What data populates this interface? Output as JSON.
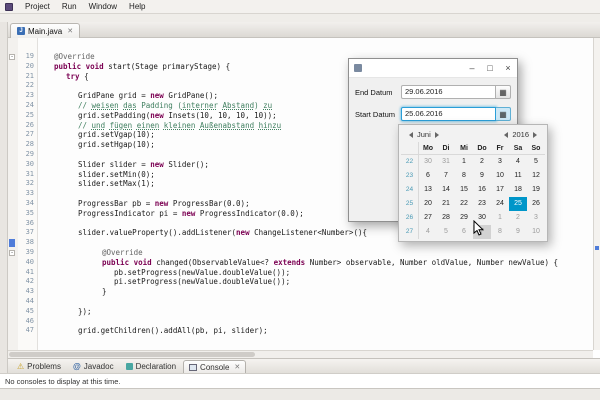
{
  "menubar": {
    "items": [
      "Project",
      "Run",
      "Window",
      "Help"
    ]
  },
  "editor": {
    "tab": "Main.java",
    "tab_close": "✕",
    "fold_glyph": "-",
    "lines": [
      {
        "n": 19,
        "i": 1,
        "fold": true,
        "s": [
          [
            "@Override",
            "ann"
          ]
        ]
      },
      {
        "n": 20,
        "i": 1,
        "s": [
          [
            "public ",
            "kw"
          ],
          [
            "void ",
            "kw"
          ],
          [
            "start(Stage primaryStage) {",
            "p"
          ]
        ]
      },
      {
        "n": 21,
        "i": 2,
        "s": [
          [
            "try ",
            "kw"
          ],
          [
            "{",
            "p"
          ]
        ]
      },
      {
        "n": 22,
        "i": 0,
        "s": []
      },
      {
        "n": 23,
        "i": 3,
        "s": [
          [
            "GridPane grid = ",
            "p"
          ],
          [
            "new ",
            "kw"
          ],
          [
            "GridPane();",
            "p"
          ]
        ]
      },
      {
        "n": 24,
        "i": 3,
        "s": [
          [
            "// ",
            "com"
          ],
          [
            "weisen",
            "comu"
          ],
          [
            " ",
            "com"
          ],
          [
            "das",
            "comu"
          ],
          [
            " Padding (",
            "com"
          ],
          [
            "interner",
            "comu"
          ],
          [
            " ",
            "com"
          ],
          [
            "Abstand",
            "comu"
          ],
          [
            ") ",
            "com"
          ],
          [
            "zu",
            "comu"
          ]
        ]
      },
      {
        "n": 25,
        "i": 3,
        "s": [
          [
            "grid.setPadding(",
            "p"
          ],
          [
            "new ",
            "kw"
          ],
          [
            "Insets(10, 10, 10, 10));",
            "p"
          ]
        ]
      },
      {
        "n": 26,
        "i": 3,
        "s": [
          [
            "// ",
            "com"
          ],
          [
            "und",
            "comu"
          ],
          [
            " ",
            "com"
          ],
          [
            "fügen",
            "comu"
          ],
          [
            " ",
            "com"
          ],
          [
            "einen",
            "comu"
          ],
          [
            " ",
            "com"
          ],
          [
            "kleinen",
            "comu"
          ],
          [
            " ",
            "com"
          ],
          [
            "Außenabstand",
            "comu"
          ],
          [
            " ",
            "com"
          ],
          [
            "hinzu",
            "comu"
          ]
        ]
      },
      {
        "n": 27,
        "i": 3,
        "s": [
          [
            "grid.setVgap(10);",
            "p"
          ]
        ]
      },
      {
        "n": 28,
        "i": 3,
        "s": [
          [
            "grid.setHgap(10);",
            "p"
          ]
        ]
      },
      {
        "n": 29,
        "i": 0,
        "s": []
      },
      {
        "n": 30,
        "i": 3,
        "s": [
          [
            "Slider slider = ",
            "p"
          ],
          [
            "new ",
            "kw"
          ],
          [
            "Slider();",
            "p"
          ]
        ]
      },
      {
        "n": 31,
        "i": 3,
        "s": [
          [
            "slider.setMin(0);",
            "p"
          ]
        ]
      },
      {
        "n": 32,
        "i": 3,
        "s": [
          [
            "slider.setMax(1);",
            "p"
          ]
        ]
      },
      {
        "n": 33,
        "i": 0,
        "s": []
      },
      {
        "n": 34,
        "i": 3,
        "s": [
          [
            "ProgressBar pb = ",
            "p"
          ],
          [
            "new ",
            "kw"
          ],
          [
            "ProgressBar(0.0);",
            "p"
          ]
        ]
      },
      {
        "n": 35,
        "i": 3,
        "s": [
          [
            "ProgressIndicator pi = ",
            "p"
          ],
          [
            "new ",
            "kw"
          ],
          [
            "ProgressIndicator(0.0);",
            "p"
          ]
        ]
      },
      {
        "n": 36,
        "i": 0,
        "s": []
      },
      {
        "n": 37,
        "i": 3,
        "s": [
          [
            "slider.valueProperty().addListener(",
            "p"
          ],
          [
            "new ",
            "kw"
          ],
          [
            "ChangeListener<Number>(){",
            "p"
          ]
        ]
      },
      {
        "n": 38,
        "i": 0,
        "mark": true,
        "s": []
      },
      {
        "n": 39,
        "i": 5,
        "fold": true,
        "s": [
          [
            "@Override",
            "ann"
          ]
        ]
      },
      {
        "n": 40,
        "i": 5,
        "s": [
          [
            "public ",
            "kw"
          ],
          [
            "void ",
            "kw"
          ],
          [
            "changed(ObservableValue<? ",
            "p"
          ],
          [
            "extends ",
            "kw"
          ],
          [
            "Number> observable, Number oldValue, Number newValue) {",
            "p"
          ]
        ]
      },
      {
        "n": 41,
        "i": 6,
        "s": [
          [
            "pb.setProgress(newValue.doubleValue());",
            "p"
          ]
        ]
      },
      {
        "n": 42,
        "i": 6,
        "s": [
          [
            "pi.setProgress(newValue.doubleValue());",
            "p"
          ]
        ]
      },
      {
        "n": 43,
        "i": 5,
        "s": [
          [
            "}",
            "p"
          ]
        ]
      },
      {
        "n": 44,
        "i": 0,
        "s": []
      },
      {
        "n": 45,
        "i": 3,
        "s": [
          [
            "});",
            "p"
          ]
        ]
      },
      {
        "n": 46,
        "i": 0,
        "s": []
      },
      {
        "n": 47,
        "i": 3,
        "s": [
          [
            "grid.getChildren().addAll(pb, pi, slider);",
            "p"
          ]
        ]
      }
    ]
  },
  "dialog": {
    "minimize": "–",
    "maximize": "□",
    "close": "×",
    "picker_icon": "▦",
    "rows": [
      {
        "label": "End Datum",
        "value": "29.06.2016"
      },
      {
        "label": "Start Datum",
        "value": "25.06.2016"
      }
    ]
  },
  "calendar": {
    "month": "Juni",
    "year": "2016",
    "day_headers": [
      "Mo",
      "Di",
      "Mi",
      "Do",
      "Fr",
      "Sa",
      "So"
    ],
    "weeks": [
      {
        "wn": "22",
        "days": [
          [
            "30",
            "o"
          ],
          [
            "31",
            "o"
          ],
          [
            "1",
            ""
          ],
          [
            "2",
            ""
          ],
          [
            "3",
            ""
          ],
          [
            "4",
            ""
          ],
          [
            "5",
            ""
          ]
        ]
      },
      {
        "wn": "23",
        "days": [
          [
            "6",
            ""
          ],
          [
            "7",
            ""
          ],
          [
            "8",
            ""
          ],
          [
            "9",
            ""
          ],
          [
            "10",
            ""
          ],
          [
            "11",
            ""
          ],
          [
            "12",
            ""
          ]
        ]
      },
      {
        "wn": "24",
        "days": [
          [
            "13",
            ""
          ],
          [
            "14",
            ""
          ],
          [
            "15",
            ""
          ],
          [
            "16",
            ""
          ],
          [
            "17",
            ""
          ],
          [
            "18",
            ""
          ],
          [
            "19",
            ""
          ]
        ]
      },
      {
        "wn": "25",
        "days": [
          [
            "20",
            ""
          ],
          [
            "21",
            ""
          ],
          [
            "22",
            ""
          ],
          [
            "23",
            ""
          ],
          [
            "24",
            ""
          ],
          [
            "25",
            "sel"
          ],
          [
            "26",
            ""
          ]
        ]
      },
      {
        "wn": "26",
        "days": [
          [
            "27",
            ""
          ],
          [
            "28",
            ""
          ],
          [
            "29",
            ""
          ],
          [
            "30",
            ""
          ],
          [
            "1",
            "o"
          ],
          [
            "2",
            "o"
          ],
          [
            "3",
            "o"
          ]
        ]
      },
      {
        "wn": "27",
        "days": [
          [
            "4",
            "o"
          ],
          [
            "5",
            "o"
          ],
          [
            "6",
            "o"
          ],
          [
            "7",
            "o hov"
          ],
          [
            "8",
            "o"
          ],
          [
            "9",
            "o"
          ],
          [
            "10",
            "o"
          ]
        ]
      }
    ]
  },
  "panel": {
    "tabs": [
      "Problems",
      "Javadoc",
      "Declaration",
      "Console"
    ],
    "tab_close": "✕",
    "message": "No consoles to display at this time."
  }
}
